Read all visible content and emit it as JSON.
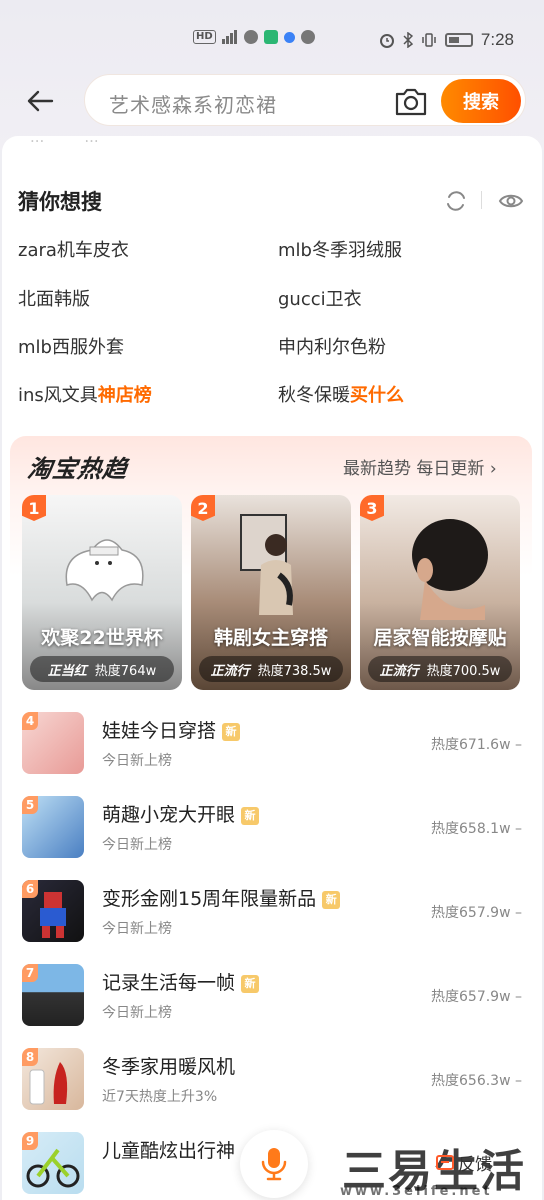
{
  "status_bar": {
    "time": "7:28",
    "left_icons": [
      "hd-icon",
      "signal-icon",
      "wechat-icon",
      "app-icon",
      "dot-icon",
      "message-icon"
    ],
    "right_icons": [
      "alarm-icon",
      "bluetooth-icon",
      "vibrate-icon",
      "battery-icon"
    ]
  },
  "search": {
    "placeholder": "艺术感森系初恋裙",
    "button_label": "搜索"
  },
  "faded_history": [
    "...",
    "..."
  ],
  "guess": {
    "title": "猜你想搜",
    "items": [
      {
        "text": "zara机车皮衣",
        "highlight": ""
      },
      {
        "text": "mlb冬季羽绒服",
        "highlight": ""
      },
      {
        "text": "北面韩版",
        "highlight": ""
      },
      {
        "text": "gucci卫衣",
        "highlight": ""
      },
      {
        "text": "mlb西服外套",
        "highlight": ""
      },
      {
        "text": "申内利尔色粉",
        "highlight": ""
      },
      {
        "text": "ins风文具",
        "highlight": "神店榜"
      },
      {
        "text": "秋冬保暖",
        "highlight": "买什么"
      }
    ]
  },
  "trends": {
    "brand": "淘宝热趋",
    "more": "最新趋势 每日更新",
    "cards": [
      {
        "rank": "1",
        "title": "欢聚22世界杯",
        "tag": "正当红",
        "heat": "热度764w"
      },
      {
        "rank": "2",
        "title": "韩剧女主穿搭",
        "tag": "正流行",
        "heat": "热度738.5w"
      },
      {
        "rank": "3",
        "title": "居家智能按摩贴",
        "tag": "正流行",
        "heat": "热度700.5w"
      }
    ],
    "list": [
      {
        "rank": "4",
        "title": "娃娃今日穿搭",
        "sub": "今日新上榜",
        "heat": "热度671.6w",
        "badge": "新"
      },
      {
        "rank": "5",
        "title": "萌趣小宠大开眼",
        "sub": "今日新上榜",
        "heat": "热度658.1w",
        "badge": "新"
      },
      {
        "rank": "6",
        "title": "变形金刚15周年限量新品",
        "sub": "今日新上榜",
        "heat": "热度657.9w",
        "badge": "新"
      },
      {
        "rank": "7",
        "title": "记录生活每一帧",
        "sub": "今日新上榜",
        "heat": "热度657.9w",
        "badge": "新"
      },
      {
        "rank": "8",
        "title": "冬季家用暖风机",
        "sub": "近7天热度上升3%",
        "heat": "热度656.3w",
        "badge": ""
      },
      {
        "rank": "9",
        "title": "儿童酷炫出行神",
        "sub": "",
        "heat": "",
        "badge": ""
      }
    ]
  },
  "bottom": {
    "feedback_label": "反馈",
    "watermark": "三易生活",
    "watermark_url": "www.3elife.net"
  },
  "colors": {
    "accent": "#ff5000",
    "highlight": "#ff6a00",
    "badge": "#f7c96a"
  }
}
